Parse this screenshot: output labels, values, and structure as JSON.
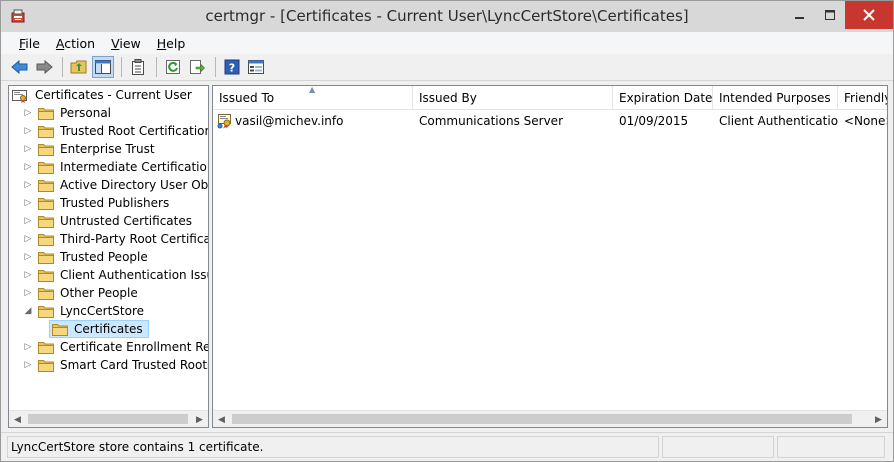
{
  "window": {
    "title": "certmgr - [Certificates - Current User\\LyncCertStore\\Certificates]"
  },
  "menu": [
    {
      "pre": "",
      "key": "F",
      "post": "ile"
    },
    {
      "pre": "",
      "key": "A",
      "post": "ction"
    },
    {
      "pre": "",
      "key": "V",
      "post": "iew"
    },
    {
      "pre": "",
      "key": "H",
      "post": "elp"
    }
  ],
  "toolbar": {
    "icons": [
      "back-arrow-icon",
      "forward-arrow-icon",
      "up-folder-icon",
      "show-tree-icon",
      "properties-icon",
      "refresh-icon",
      "export-list-icon",
      "help-icon",
      "console-icon"
    ]
  },
  "tree": {
    "root": "Certificates - Current User",
    "items": [
      {
        "label": "Personal",
        "expander": "right"
      },
      {
        "label": "Trusted Root Certification Au",
        "expander": "right"
      },
      {
        "label": "Enterprise Trust",
        "expander": "right"
      },
      {
        "label": "Intermediate Certification Au",
        "expander": "right"
      },
      {
        "label": "Active Directory User Object",
        "expander": "right"
      },
      {
        "label": "Trusted Publishers",
        "expander": "right"
      },
      {
        "label": "Untrusted Certificates",
        "expander": "right"
      },
      {
        "label": "Third-Party Root Certification",
        "expander": "right"
      },
      {
        "label": "Trusted People",
        "expander": "right"
      },
      {
        "label": "Client Authentication Issuers",
        "expander": "right"
      },
      {
        "label": "Other People",
        "expander": "right"
      },
      {
        "label": "LyncCertStore",
        "expander": "down"
      },
      {
        "label": "Certificates",
        "expander": "none",
        "selected": true,
        "child": true
      },
      {
        "label": "Certificate Enrollment Reques",
        "expander": "right"
      },
      {
        "label": "Smart Card Trusted Roots",
        "expander": "right"
      }
    ]
  },
  "list": {
    "columns": [
      "Issued To",
      "Issued By",
      "Expiration Date",
      "Intended Purposes",
      "Friendly"
    ],
    "rows": [
      [
        "vasil@michev.info",
        "Communications Server",
        "01/09/2015",
        "Client Authentication",
        "<None>"
      ]
    ]
  },
  "status": {
    "text": "LyncCertStore store contains 1 certificate."
  },
  "colors": {
    "title_bar": "#d8d8d8",
    "close_button": "#c7372f",
    "selection": "#cce8ff",
    "folder": "#e8c460"
  }
}
